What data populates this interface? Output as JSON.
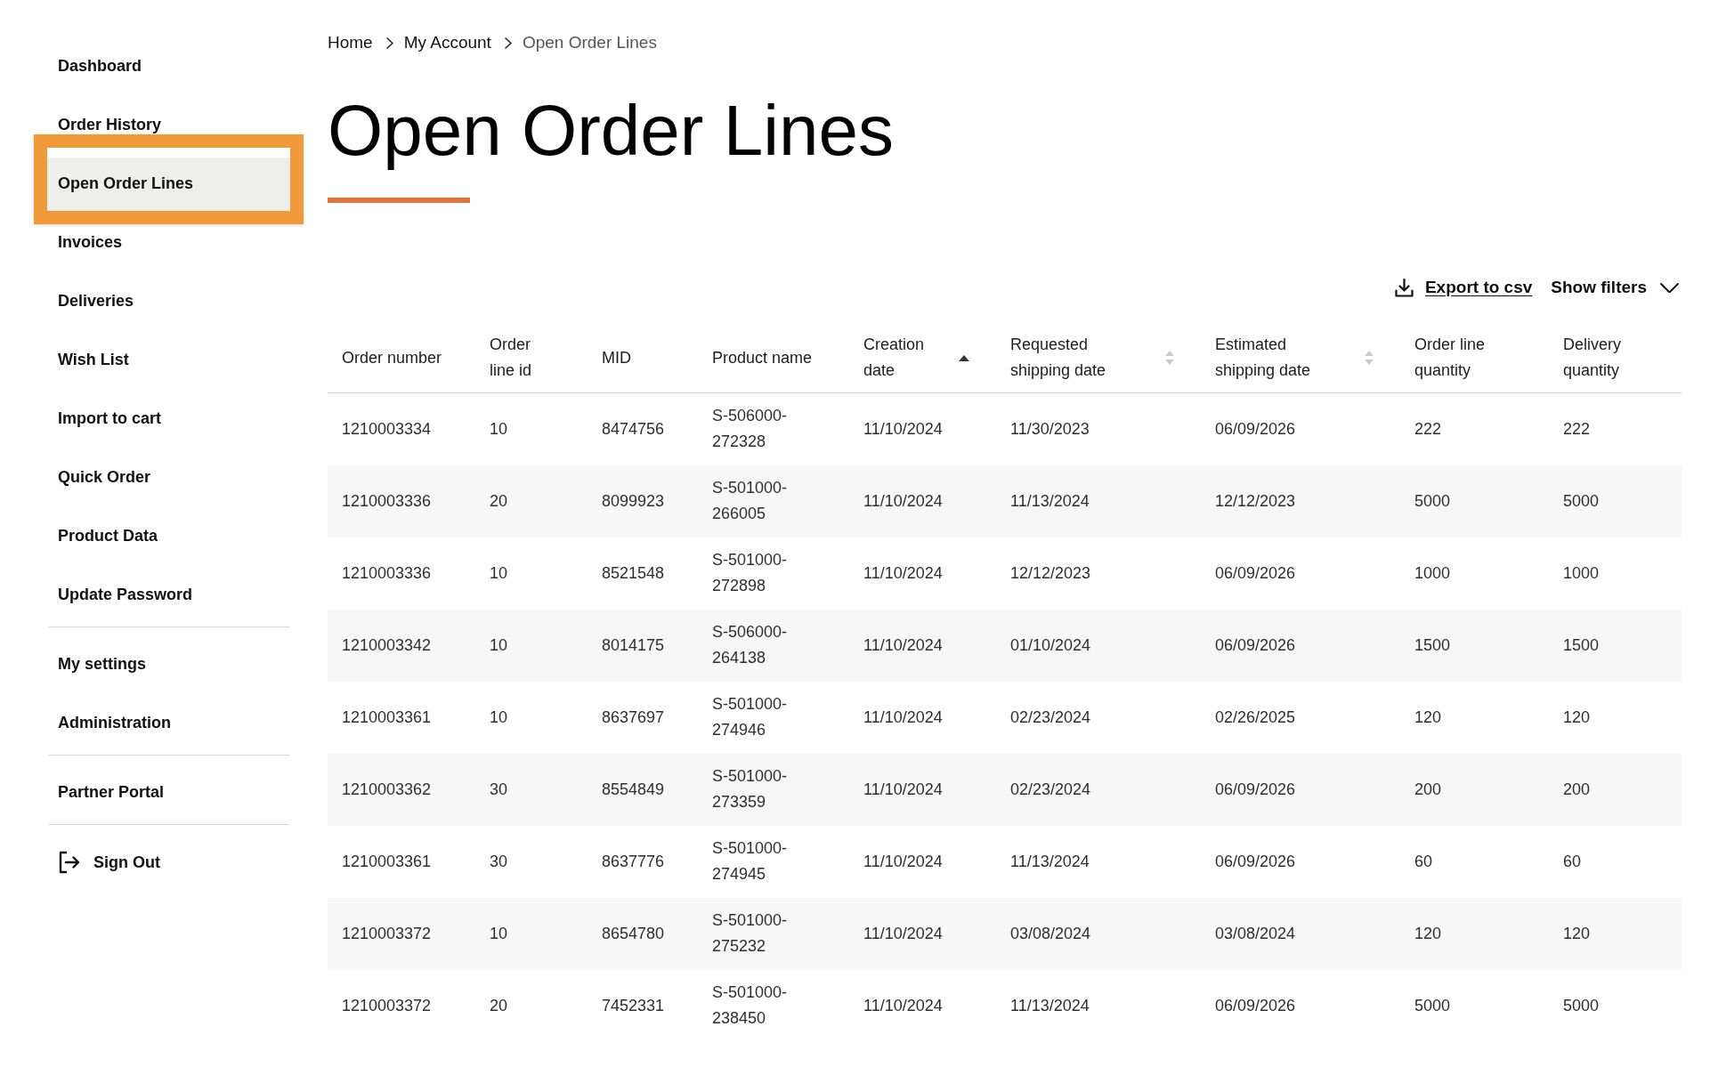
{
  "sidebar": {
    "sections": [
      {
        "items": [
          {
            "label": "Dashboard",
            "selected": false,
            "kind": "link"
          },
          {
            "label": "Order History",
            "selected": false,
            "kind": "link"
          },
          {
            "label": "Open Order Lines",
            "selected": true,
            "kind": "link"
          },
          {
            "label": "Invoices",
            "selected": false,
            "kind": "link"
          },
          {
            "label": "Deliveries",
            "selected": false,
            "kind": "link"
          },
          {
            "label": "Wish List",
            "selected": false,
            "kind": "link"
          },
          {
            "label": "Import to cart",
            "selected": false,
            "kind": "link"
          },
          {
            "label": "Quick Order",
            "selected": false,
            "kind": "link"
          },
          {
            "label": "Product Data",
            "selected": false,
            "kind": "link"
          },
          {
            "label": "Update Password",
            "selected": false,
            "kind": "link"
          }
        ]
      },
      {
        "items": [
          {
            "label": "My settings",
            "selected": false,
            "kind": "link"
          },
          {
            "label": "Administration",
            "selected": false,
            "kind": "link"
          }
        ]
      },
      {
        "items": [
          {
            "label": "Partner Portal",
            "selected": false,
            "kind": "link"
          }
        ]
      },
      {
        "items": [
          {
            "label": "Sign Out",
            "selected": false,
            "kind": "sign_out"
          }
        ]
      }
    ]
  },
  "breadcrumb": [
    {
      "label": "Home",
      "current": false
    },
    {
      "label": "My Account",
      "current": false
    },
    {
      "label": "Open Order Lines",
      "current": true
    }
  ],
  "page": {
    "title": "Open Order Lines"
  },
  "toolbar": {
    "export": "Export to csv",
    "filters": {
      "label": "Show filters",
      "expanded": false
    }
  },
  "table": {
    "columns": [
      {
        "label": "Order number",
        "sortable": false
      },
      {
        "label": "Order line id",
        "sortable": false
      },
      {
        "label": "MID",
        "sortable": false
      },
      {
        "label": "Product name",
        "sortable": false
      },
      {
        "label": "Creation date",
        "sortable": true,
        "sorted": true
      },
      {
        "label": "Requested shipping date",
        "sortable": true,
        "sorted": false
      },
      {
        "label": "Estimated shipping date",
        "sortable": true,
        "sorted": false
      },
      {
        "label": "Order line quantity",
        "sortable": false
      },
      {
        "label": "Delivery quantity",
        "sortable": false
      }
    ],
    "rows": [
      [
        "1210003334",
        "10",
        "8474756",
        "S-506000-272328",
        "11/10/2024",
        "11/30/2023",
        "06/09/2026",
        "222",
        "222"
      ],
      [
        "1210003336",
        "20",
        "8099923",
        "S-501000-266005",
        "11/10/2024",
        "11/13/2024",
        "12/12/2023",
        "5000",
        "5000"
      ],
      [
        "1210003336",
        "10",
        "8521548",
        "S-501000-272898",
        "11/10/2024",
        "12/12/2023",
        "06/09/2026",
        "1000",
        "1000"
      ],
      [
        "1210003342",
        "10",
        "8014175",
        "S-506000-264138",
        "11/10/2024",
        "01/10/2024",
        "06/09/2026",
        "1500",
        "1500"
      ],
      [
        "1210003361",
        "10",
        "8637697",
        "S-501000-274946",
        "11/10/2024",
        "02/23/2024",
        "02/26/2025",
        "120",
        "120"
      ],
      [
        "1210003362",
        "30",
        "8554849",
        "S-501000-273359",
        "11/10/2024",
        "02/23/2024",
        "06/09/2026",
        "200",
        "200"
      ],
      [
        "1210003361",
        "30",
        "8637776",
        "S-501000-274945",
        "11/10/2024",
        "11/13/2024",
        "06/09/2026",
        "60",
        "60"
      ],
      [
        "1210003372",
        "10",
        "8654780",
        "S-501000-275232",
        "11/10/2024",
        "03/08/2024",
        "03/08/2024",
        "120",
        "120"
      ],
      [
        "1210003372",
        "20",
        "7452331",
        "S-501000-238450",
        "11/10/2024",
        "11/13/2024",
        "06/09/2026",
        "5000",
        "5000"
      ]
    ]
  }
}
